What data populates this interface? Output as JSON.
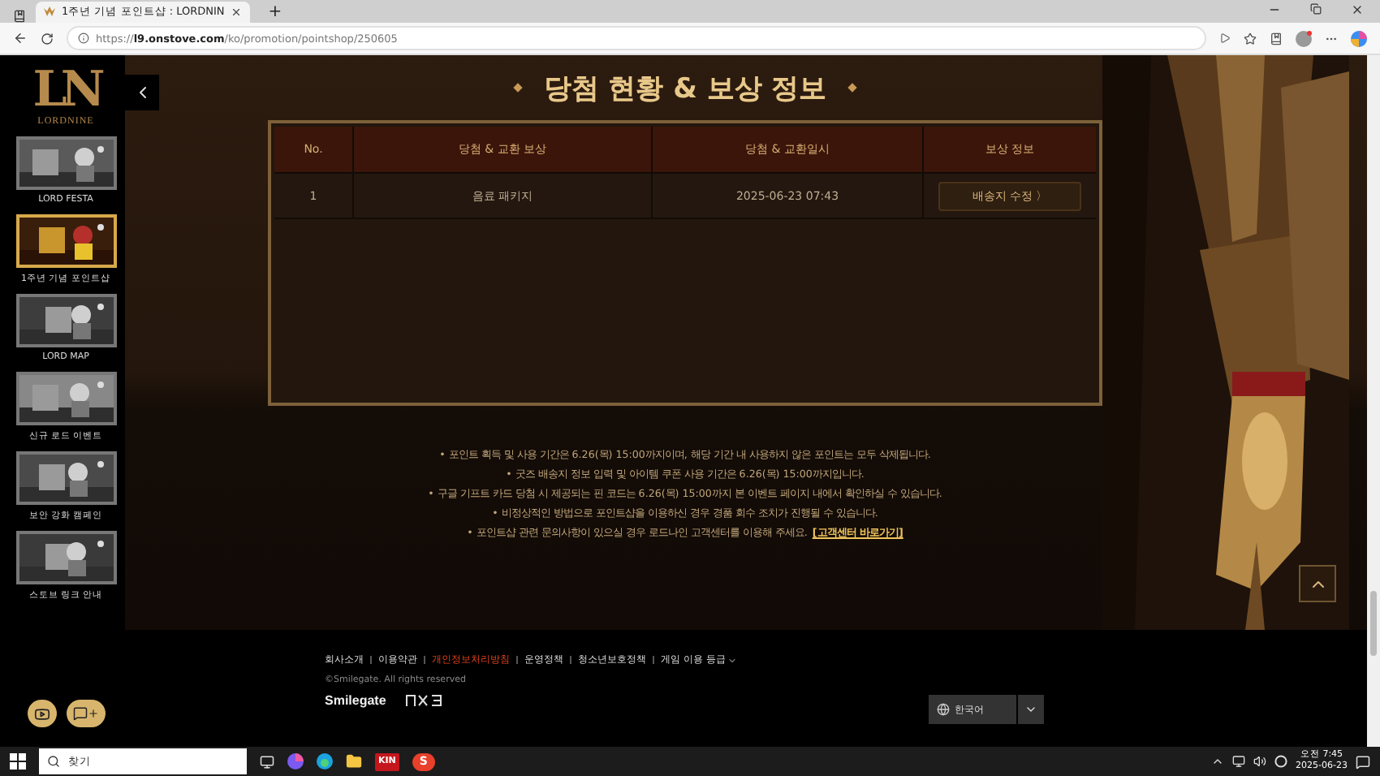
{
  "browser": {
    "tab_title": "1주년 기념 포인트샵 : LORDNIN",
    "new_tab": "+",
    "url": "https://**l9.onstove.com**/ko/promotion/pointshop/250605"
  },
  "sidebar": {
    "logo_mark": "LN",
    "logo_name": "LORDNINE",
    "items": [
      {
        "label": "LORD FESTA",
        "selected": false
      },
      {
        "label": "1주년 기념 포인트샵",
        "selected": true
      },
      {
        "label": "LORD MAP",
        "selected": false
      },
      {
        "label": "신규 로드 이벤트",
        "selected": false
      },
      {
        "label": "보안 강화 캠페인",
        "selected": false
      },
      {
        "label": "스토브 링크 안내",
        "selected": false
      }
    ]
  },
  "title": "당첨 현황 & 보상 정보",
  "table": {
    "columns": [
      "No.",
      "당첨 & 교환 보상",
      "당첨 & 교환일시",
      "보상 정보"
    ],
    "rows": [
      {
        "cells": [
          "1",
          "음료 패키지",
          "2025-06-23 07:43"
        ],
        "action": "배송지 수정 〉"
      }
    ]
  },
  "notes": [
    {
      "text": "• 포인트 획득 및 사용 기간은 6.26(목) 15:00까지이며, 해당 기간 내 사용하지 않은 포인트는 모두 삭제됩니다."
    },
    {
      "text": "• 굿즈 배송지 정보 입력 및 아이템 쿠폰 사용 기간은 6.26(목) 15:00까지입니다."
    },
    {
      "text": "• 구글 기프트 카드 당첨 시 제공되는 핀 코드는 6.26(목) 15:00까지 본 이벤트 페이지 내에서 확인하실 수 있습니다."
    },
    {
      "text": "• 비정상적인 방법으로 포인트샵을 이용하신 경우 경품 회수 조치가 진행될 수 있습니다."
    },
    {
      "text": "•  포인트샵 관련 문의사항이 있으실 경우 로드나인 고객센터를 이용해 주세요.",
      "link": "[고객센터 바로가기]"
    }
  ],
  "footer": {
    "links": [
      {
        "label": "회사소개",
        "highlighted": false,
        "dropdown": false
      },
      {
        "label": "이용약관",
        "highlighted": false,
        "dropdown": false
      },
      {
        "label": "개인정보처리방침",
        "highlighted": true,
        "dropdown": false
      },
      {
        "label": "운영정책",
        "highlighted": false,
        "dropdown": false
      },
      {
        "label": "청소년보호정책",
        "highlighted": false,
        "dropdown": false
      },
      {
        "label": "게임 이용 등급",
        "highlighted": false,
        "dropdown": true
      }
    ],
    "copyright": "©Smilegate. All rights reserved",
    "brand": "Smilegate",
    "language": "한국어"
  },
  "taskbar": {
    "search_placeholder": "찾기",
    "kin_label": "KIN",
    "s_label": "S",
    "time": "오전 7:45",
    "date": "2025-06-23"
  }
}
